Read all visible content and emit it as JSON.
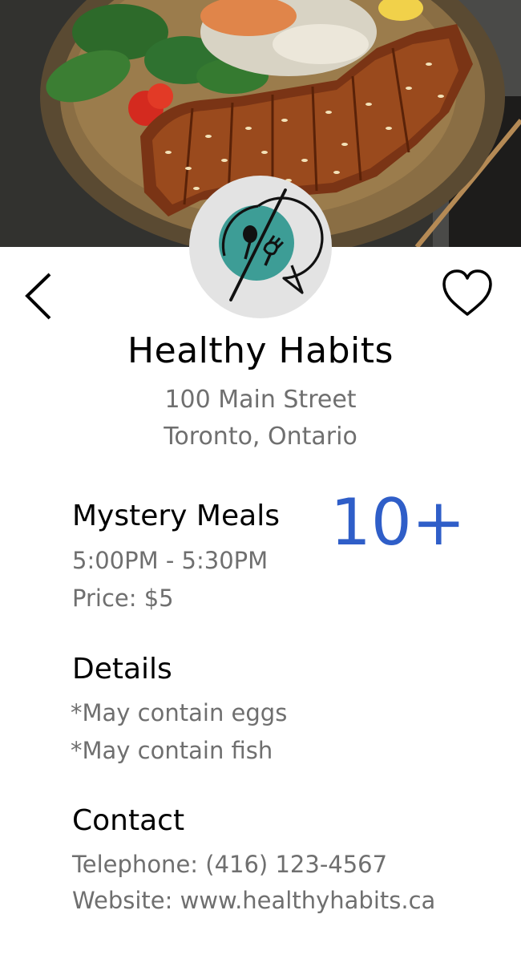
{
  "restaurant": {
    "name": "Healthy Habits",
    "address_line1": "100 Main Street",
    "address_line2": "Toronto, Ontario"
  },
  "meals": {
    "heading": "Mystery Meals",
    "time": "5:00PM - 5:30PM",
    "price": "Price: $5",
    "count": "10+"
  },
  "details": {
    "heading": "Details",
    "items": [
      "*May contain eggs",
      "*May contain fish"
    ]
  },
  "contact": {
    "heading": "Contact",
    "telephone": "Telephone: (416) 123-4567",
    "website": "Website: www.healthyhabits.ca"
  },
  "icons": {
    "back": "chevron-left-icon",
    "favorite": "heart-outline-icon",
    "logo": "no-food-speech-bubble-icon"
  },
  "colors": {
    "accent": "#2f5ec8",
    "logo_teal": "#3d9d96",
    "secondary_text": "#6f6f6f"
  }
}
